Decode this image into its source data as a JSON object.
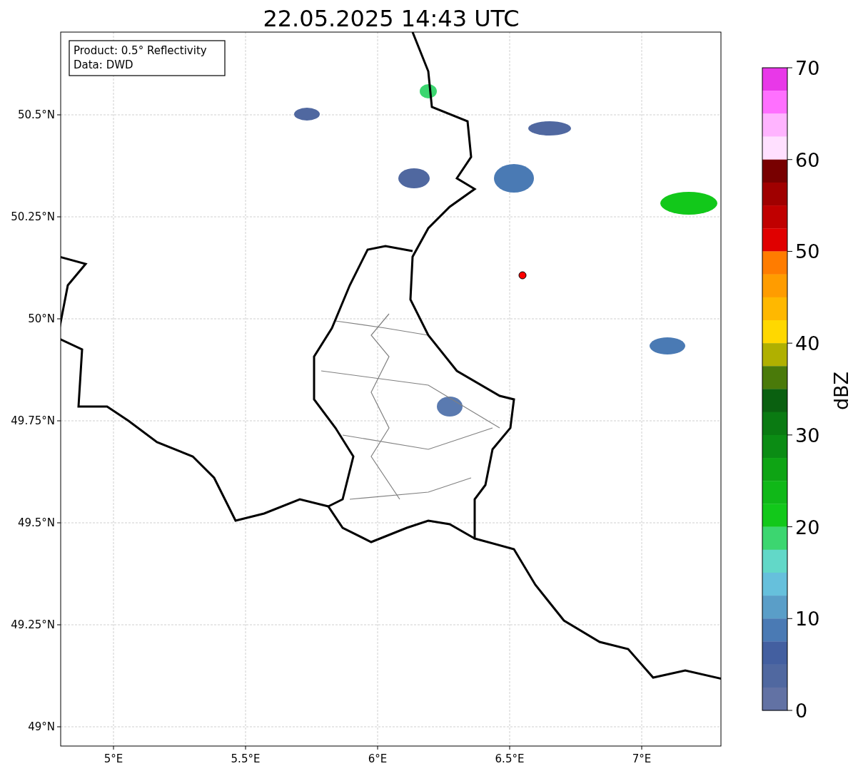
{
  "title": "22.05.2025 14:43 UTC",
  "info_box": [
    "Product: 0.5° Reflectivity",
    "Data: DWD"
  ],
  "x_ticks": [
    "5°E",
    "5.5°E",
    "6°E",
    "6.5°E",
    "7°E"
  ],
  "y_ticks": [
    "50.5°N",
    "50.25°N",
    "50°N",
    "49.75°N",
    "49.5°N",
    "49.25°N",
    "49°N"
  ],
  "colorbar": {
    "label": "dBZ",
    "ticks": [
      "70",
      "60",
      "50",
      "40",
      "30",
      "20",
      "10",
      "0"
    ],
    "bins": [
      {
        "color": "#e838e8"
      },
      {
        "color": "#ff70ff"
      },
      {
        "color": "#ffb4ff"
      },
      {
        "color": "#ffe0ff"
      },
      {
        "color": "#780000"
      },
      {
        "color": "#a00000"
      },
      {
        "color": "#c00000"
      },
      {
        "color": "#e00000"
      },
      {
        "color": "#ff7c00"
      },
      {
        "color": "#ff9c00"
      },
      {
        "color": "#ffb800"
      },
      {
        "color": "#ffd800"
      },
      {
        "color": "#b0b000"
      },
      {
        "color": "#4a7a0a"
      },
      {
        "color": "#0a6010"
      },
      {
        "color": "#0a7a12"
      },
      {
        "color": "#0b8c14"
      },
      {
        "color": "#0ea414"
      },
      {
        "color": "#10b818"
      },
      {
        "color": "#12c81a"
      },
      {
        "color": "#3cd670"
      },
      {
        "color": "#62d8c8"
      },
      {
        "color": "#66c0dc"
      },
      {
        "color": "#5a9ec8"
      },
      {
        "color": "#4a7ab4"
      },
      {
        "color": "#435fa0"
      },
      {
        "color": "#5068a0"
      },
      {
        "color": "#6272a4"
      }
    ]
  }
}
